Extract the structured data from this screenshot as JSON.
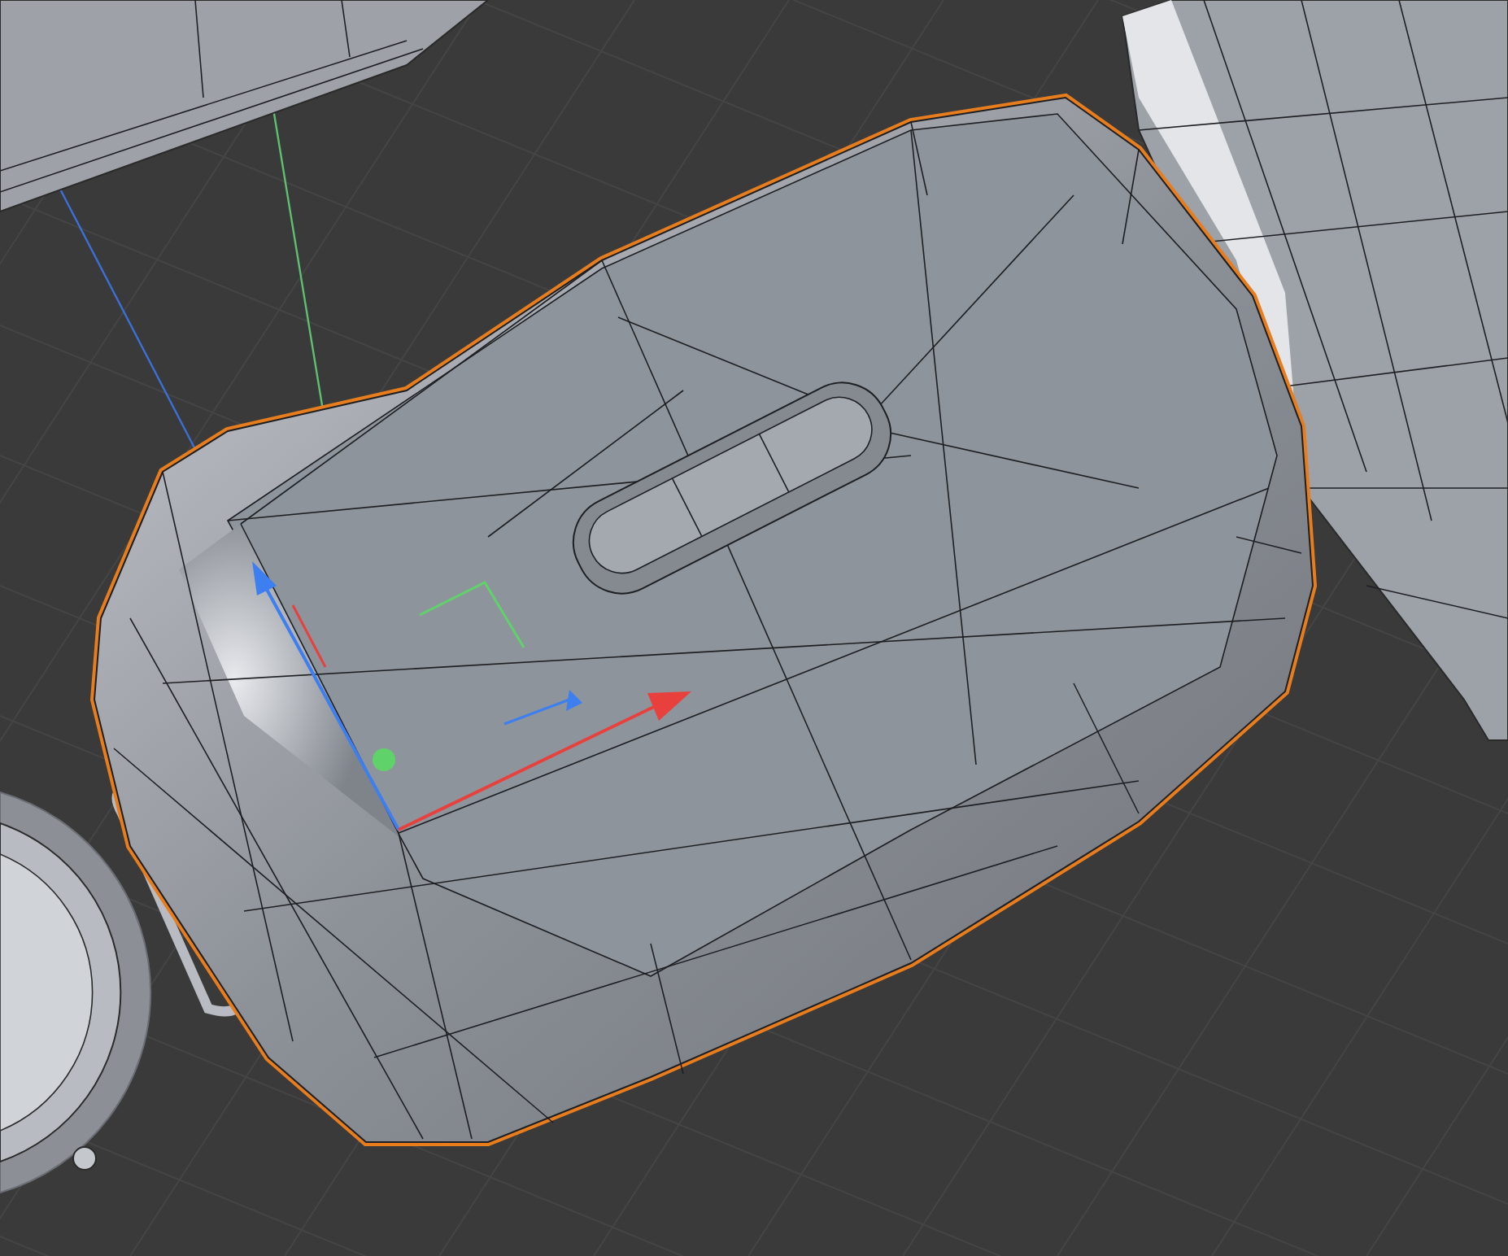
{
  "viewport": {
    "objects": [
      {
        "kind": "plate",
        "selected": false
      },
      {
        "kind": "panel",
        "selected": false
      },
      {
        "kind": "lid",
        "selected": true
      },
      {
        "kind": "disc",
        "selected": false
      }
    ]
  }
}
